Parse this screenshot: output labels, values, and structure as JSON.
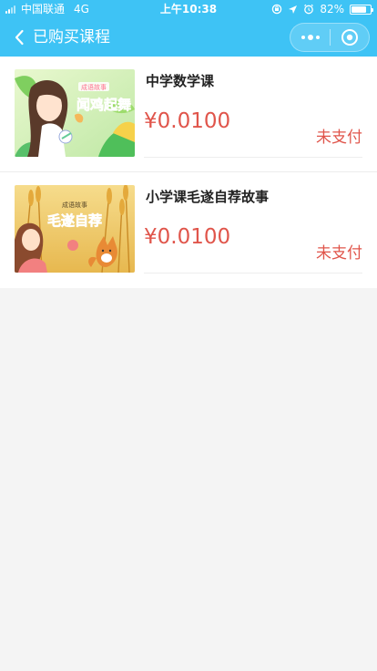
{
  "status_bar": {
    "carrier": "中国联通",
    "network": "4G",
    "time": "上午10:38",
    "battery": "82%",
    "battery_level": 0.82,
    "icons": [
      "signal-icon",
      "lock-rotation-icon",
      "location-icon",
      "alarm-icon",
      "battery-icon"
    ]
  },
  "nav": {
    "title": "已购买课程",
    "back_icon": "chevron-left-icon",
    "more_icon": "more-dots-icon",
    "close_icon": "target-close-icon"
  },
  "courses": [
    {
      "title": "中学数学课",
      "price": "¥0.0100",
      "status": "未支付",
      "thumb": {
        "tag": "成语故事",
        "title": "闻鸡起舞",
        "colors": {
          "sky": "#cfeec3",
          "accent": "#ff6f8e",
          "leaf": "#4fbf5a",
          "hair": "#5a3a2a"
        }
      }
    },
    {
      "title": "小学课毛遂自荐故事",
      "price": "¥0.0100",
      "status": "未支付",
      "thumb": {
        "tag": "成语故事",
        "title": "毛遂自荐",
        "colors": {
          "sky": "#f3cf7a",
          "accent": "#2f5fc4",
          "wheat": "#e4a93b",
          "fox": "#e88a35"
        }
      }
    }
  ],
  "colors": {
    "header": "#3ec3f5",
    "price": "#e0554b",
    "page_bg": "#f4f4f4"
  }
}
